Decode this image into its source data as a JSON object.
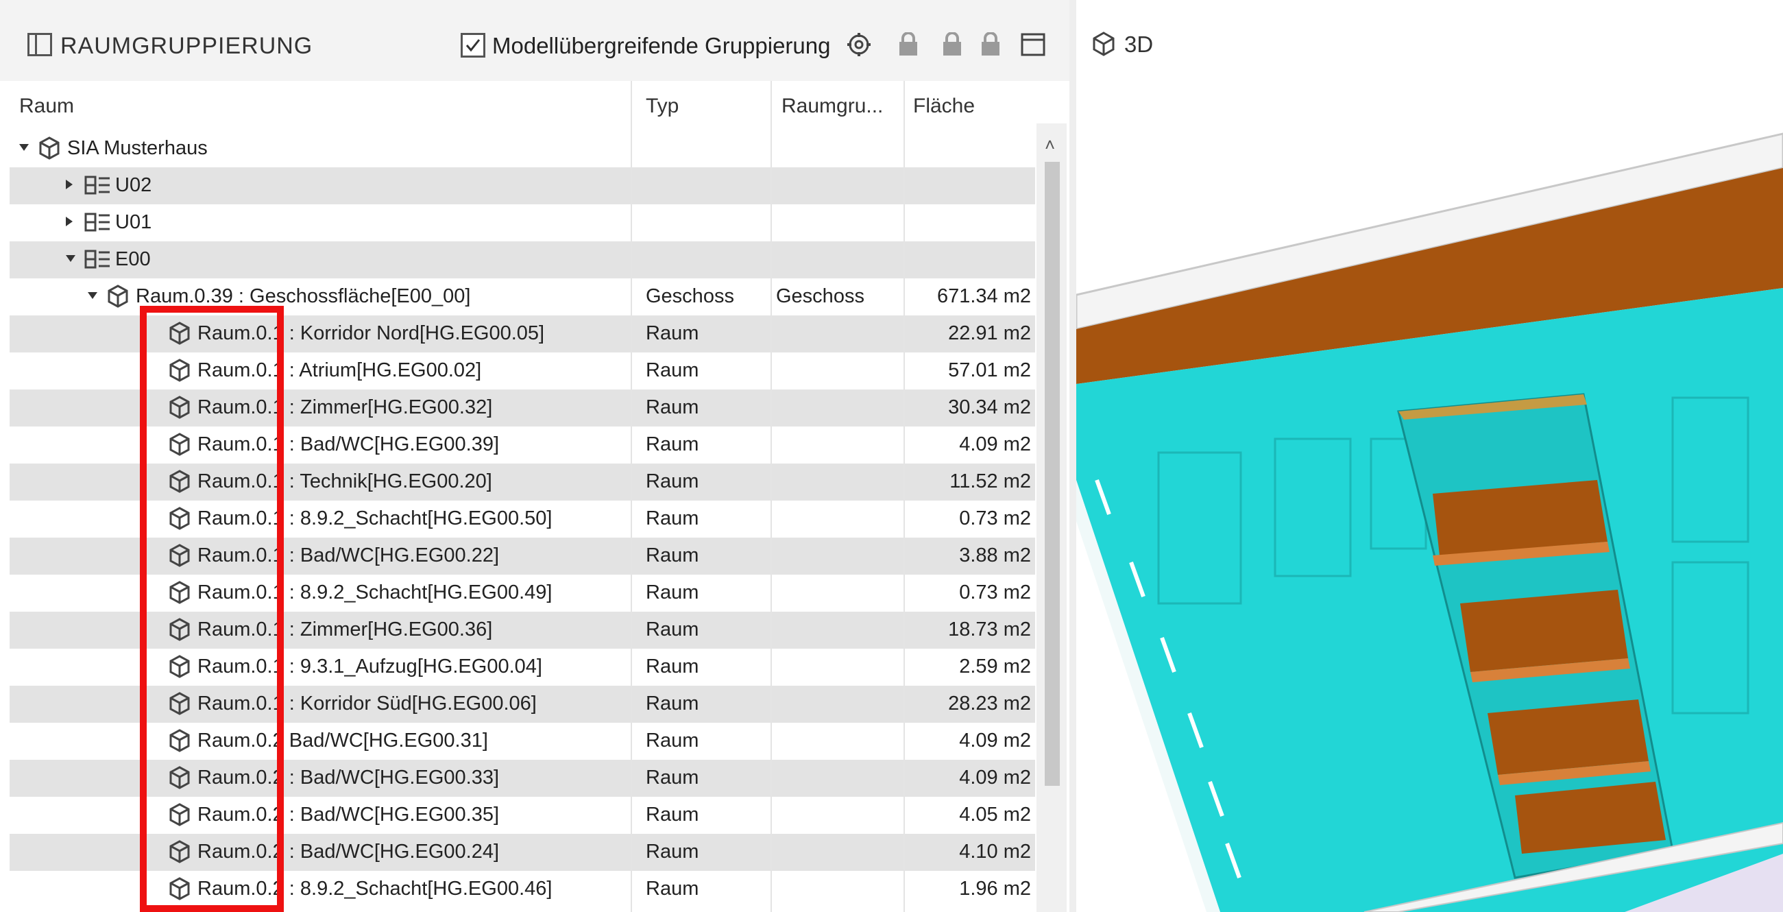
{
  "panel": {
    "title": "RAUMGRUPPIERUNG",
    "checkbox_label": "Modellübergreifende Gruppierung",
    "checkbox_checked": true
  },
  "toolbar_icons": [
    "settings-icon",
    "lock-icon",
    "lock-icon",
    "lock-icon",
    "window-icon"
  ],
  "table": {
    "columns": [
      "Raum",
      "Typ",
      "Raumgru...",
      "Fläche"
    ],
    "tree": [
      {
        "indent": 0,
        "expand": "down",
        "icon": "cube",
        "label": "SIA Musterhaus",
        "typ": "",
        "gruppe": "",
        "flaeche": ""
      },
      {
        "indent": 1,
        "expand": "right",
        "icon": "level",
        "label": "U02",
        "typ": "",
        "gruppe": "",
        "flaeche": ""
      },
      {
        "indent": 1,
        "expand": "right",
        "icon": "level",
        "label": "U01",
        "typ": "",
        "gruppe": "",
        "flaeche": ""
      },
      {
        "indent": 1,
        "expand": "down",
        "icon": "level",
        "label": "E00",
        "typ": "",
        "gruppe": "",
        "flaeche": ""
      },
      {
        "indent": 2,
        "expand": "down",
        "icon": "cube",
        "label": "Raum.0.39 : Geschossfläche[E00_00]",
        "typ": "Geschoss",
        "gruppe": "Geschoss",
        "flaeche": "671.34 m2"
      },
      {
        "indent": 3,
        "expand": "",
        "icon": "cube",
        "label": "Raum.0.1  : Korridor Nord[HG.EG00.05]",
        "typ": "Raum",
        "gruppe": "",
        "flaeche": "22.91 m2"
      },
      {
        "indent": 3,
        "expand": "",
        "icon": "cube",
        "label": "Raum.0.1  : Atrium[HG.EG00.02]",
        "typ": "Raum",
        "gruppe": "",
        "flaeche": "57.01 m2"
      },
      {
        "indent": 3,
        "expand": "",
        "icon": "cube",
        "label": "Raum.0.1  : Zimmer[HG.EG00.32]",
        "typ": "Raum",
        "gruppe": "",
        "flaeche": "30.34 m2"
      },
      {
        "indent": 3,
        "expand": "",
        "icon": "cube",
        "label": "Raum.0.1  : Bad/WC[HG.EG00.39]",
        "typ": "Raum",
        "gruppe": "",
        "flaeche": "4.09 m2"
      },
      {
        "indent": 3,
        "expand": "",
        "icon": "cube",
        "label": "Raum.0.1  : Technik[HG.EG00.20]",
        "typ": "Raum",
        "gruppe": "",
        "flaeche": "11.52 m2"
      },
      {
        "indent": 3,
        "expand": "",
        "icon": "cube",
        "label": "Raum.0.1  : 8.9.2_Schacht[HG.EG00.50]",
        "typ": "Raum",
        "gruppe": "",
        "flaeche": "0.73 m2"
      },
      {
        "indent": 3,
        "expand": "",
        "icon": "cube",
        "label": "Raum.0.1  : Bad/WC[HG.EG00.22]",
        "typ": "Raum",
        "gruppe": "",
        "flaeche": "3.88 m2"
      },
      {
        "indent": 3,
        "expand": "",
        "icon": "cube",
        "label": "Raum.0.1  : 8.9.2_Schacht[HG.EG00.49]",
        "typ": "Raum",
        "gruppe": "",
        "flaeche": "0.73 m2"
      },
      {
        "indent": 3,
        "expand": "",
        "icon": "cube",
        "label": "Raum.0.1  : Zimmer[HG.EG00.36]",
        "typ": "Raum",
        "gruppe": "",
        "flaeche": "18.73 m2"
      },
      {
        "indent": 3,
        "expand": "",
        "icon": "cube",
        "label": "Raum.0.1  : 9.3.1_Aufzug[HG.EG00.04]",
        "typ": "Raum",
        "gruppe": "",
        "flaeche": "2.59 m2"
      },
      {
        "indent": 3,
        "expand": "",
        "icon": "cube",
        "label": "Raum.0.1  : Korridor Süd[HG.EG00.06]",
        "typ": "Raum",
        "gruppe": "",
        "flaeche": "28.23 m2"
      },
      {
        "indent": 3,
        "expand": "",
        "icon": "cube",
        "label": "Raum.0.2  Bad/WC[HG.EG00.31]",
        "typ": "Raum",
        "gruppe": "",
        "flaeche": "4.09 m2"
      },
      {
        "indent": 3,
        "expand": "",
        "icon": "cube",
        "label": "Raum.0.2  : Bad/WC[HG.EG00.33]",
        "typ": "Raum",
        "gruppe": "",
        "flaeche": "4.09 m2"
      },
      {
        "indent": 3,
        "expand": "",
        "icon": "cube",
        "label": "Raum.0.2  : Bad/WC[HG.EG00.35]",
        "typ": "Raum",
        "gruppe": "",
        "flaeche": "4.05 m2"
      },
      {
        "indent": 3,
        "expand": "",
        "icon": "cube",
        "label": "Raum.0.2  : Bad/WC[HG.EG00.24]",
        "typ": "Raum",
        "gruppe": "",
        "flaeche": "4.10 m2"
      },
      {
        "indent": 3,
        "expand": "",
        "icon": "cube",
        "label": "Raum.0.2  : 8.9.2_Schacht[HG.EG00.46]",
        "typ": "Raum",
        "gruppe": "",
        "flaeche": "1.96 m2"
      }
    ]
  },
  "view3d": {
    "label": "3D"
  },
  "colors": {
    "accent_highlight": "#ee1111",
    "model_cyan": "#22d6d6",
    "model_brown": "#a6540f",
    "row_shade": "#e3e3e3"
  }
}
